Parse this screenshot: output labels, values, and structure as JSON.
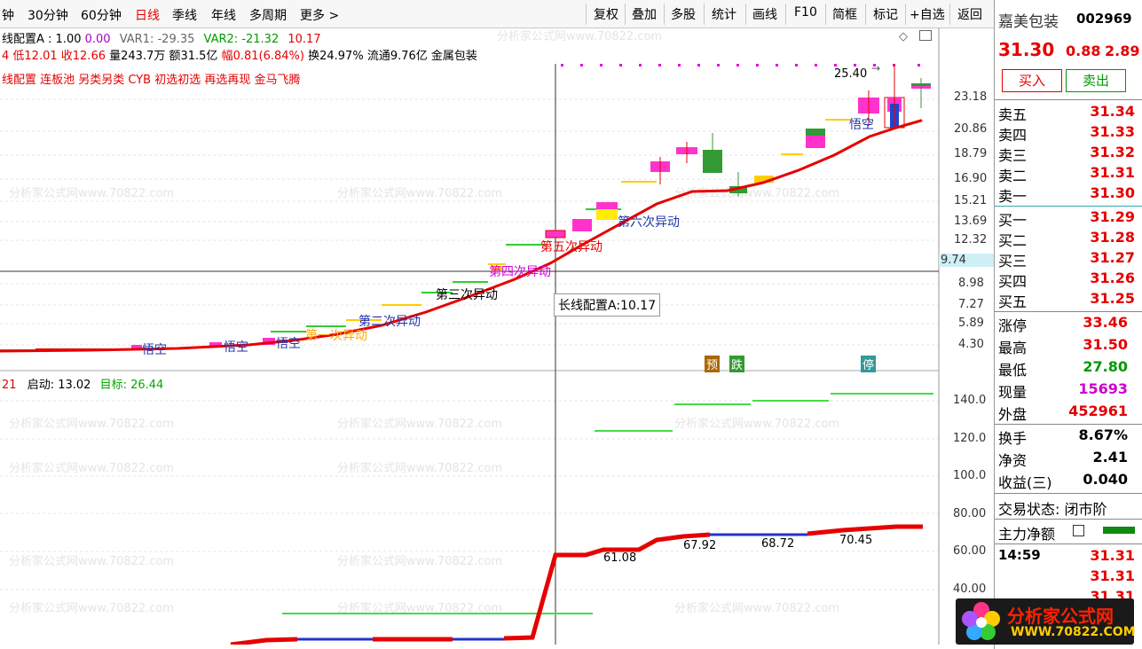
{
  "toolbar": {
    "left_items": [
      "钟",
      "30分钟",
      "60分钟",
      "日线",
      "季线",
      "年线",
      "多周期",
      "更多 >"
    ],
    "right_items": [
      "复权",
      "叠加",
      "多股",
      "统计",
      "画线",
      "F10",
      "简框",
      "标记",
      "+自选",
      "返回"
    ]
  },
  "info": {
    "line1": [
      "线配置A : 1.00",
      "0.00",
      "VAR1: -29.35",
      "VAR2: -21.32",
      "10.17"
    ],
    "line2": [
      "4 低12.01",
      "收12.66",
      "量243.7万",
      "额31.5亿",
      "幅0.81(6.84%)",
      "换24.97%",
      "流通9.76亿",
      "金属包装"
    ],
    "line3": "线配置 连板池 另类另类 CYB 初选初选 再选再现 金马飞腾",
    "lower_indicator": [
      "21",
      "启动: 13.02",
      "目标: 26.44"
    ]
  },
  "price_axis": [
    "23.18",
    "20.86",
    "18.79",
    "16.90",
    "15.21",
    "13.69",
    "12.32",
    "9.74",
    "8.98",
    "7.27",
    "5.89",
    "4.30"
  ],
  "lower_axis": [
    "140.0",
    "120.0",
    "100.0",
    "80.00",
    "60.00",
    "40.00"
  ],
  "annotations": {
    "peak": "25.40",
    "tooltip": "长线配置A:10.17",
    "signals": [
      "第一次异动",
      "第二次异动",
      "第三次异动",
      "第四次异动",
      "第五次异动",
      "第六次异动"
    ],
    "wukong": "悟空",
    "markers": [
      "预",
      "跌",
      "停"
    ],
    "lower_values": [
      "61.08",
      "67.92",
      "68.72",
      "70.45"
    ]
  },
  "stock": {
    "name": "嘉美包装",
    "code": "002969",
    "price": "31.30",
    "change": "0.88",
    "pct": "2.89",
    "buy_label": "买入",
    "sell_label": "卖出"
  },
  "asks": [
    {
      "k": "卖五",
      "v": "31.34"
    },
    {
      "k": "卖四",
      "v": "31.33"
    },
    {
      "k": "卖三",
      "v": "31.32"
    },
    {
      "k": "卖二",
      "v": "31.31"
    },
    {
      "k": "卖一",
      "v": "31.30"
    }
  ],
  "bids": [
    {
      "k": "买一",
      "v": "31.29"
    },
    {
      "k": "买二",
      "v": "31.28"
    },
    {
      "k": "买三",
      "v": "31.27"
    },
    {
      "k": "买四",
      "v": "31.26"
    },
    {
      "k": "买五",
      "v": "31.25"
    }
  ],
  "stats": [
    {
      "k": "涨停",
      "v": "33.46",
      "c": "#e60000"
    },
    {
      "k": "最高",
      "v": "31.50",
      "c": "#e60000"
    },
    {
      "k": "最低",
      "v": "27.80",
      "c": "#009900"
    },
    {
      "k": "现量",
      "v": "15693",
      "c": "#cc00cc"
    },
    {
      "k": "外盘",
      "v": "452961",
      "c": "#e60000"
    }
  ],
  "stats2": [
    {
      "k": "换手",
      "v": "8.67%"
    },
    {
      "k": "净资",
      "v": "2.41"
    },
    {
      "k": "收益(三)",
      "v": "0.040"
    }
  ],
  "trade_status": "交易状态: 闭市阶",
  "main_net": "主力净额",
  "ticks": [
    {
      "t": "14:59",
      "v": "31.31"
    },
    {
      "t": "",
      "v": "31.31"
    },
    {
      "t": "",
      "v": "31.31"
    }
  ],
  "logo": {
    "cn": "分析家公式网",
    "url": "WWW.70822.COM"
  },
  "watermark": "分析家公式网www.70822.com"
}
